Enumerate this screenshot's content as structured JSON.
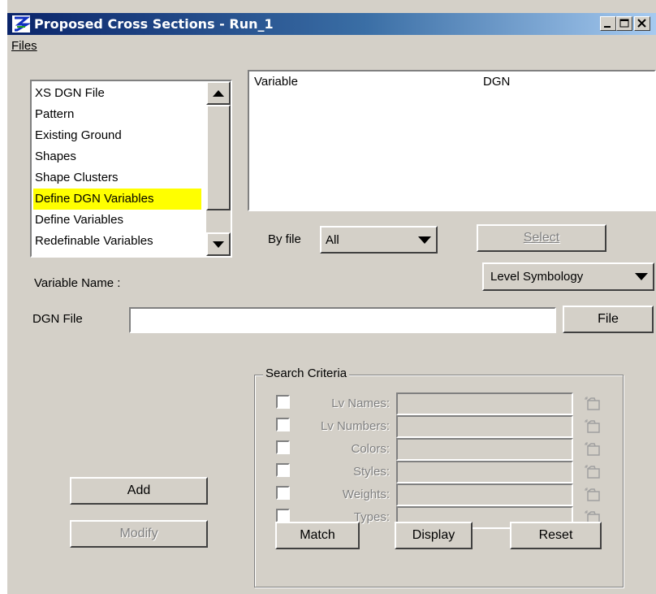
{
  "window": {
    "title": "Proposed Cross Sections - Run_1",
    "controls": {
      "minimize": "_",
      "maximize": "□",
      "close": "×"
    }
  },
  "menu": {
    "files": "Files"
  },
  "categories": {
    "items": [
      {
        "label": "XS DGN File",
        "selected": false
      },
      {
        "label": "Pattern",
        "selected": false
      },
      {
        "label": "Existing Ground",
        "selected": false
      },
      {
        "label": "Shapes",
        "selected": false
      },
      {
        "label": "Shape Clusters",
        "selected": false
      },
      {
        "label": "Define DGN Variables",
        "selected": true
      },
      {
        "label": "Define Variables",
        "selected": false
      },
      {
        "label": "Redefinable Variables",
        "selected": false
      }
    ],
    "highlight_color": "#ffff00"
  },
  "variable_table": {
    "columns": [
      "Variable",
      "DGN"
    ],
    "rows": []
  },
  "by_file": {
    "label": "By file",
    "value": "All"
  },
  "select_button": "Select",
  "variable_name_label": "Variable Name :",
  "symbology_dropdown": "Level Symbology",
  "dgn_file": {
    "label": "DGN File",
    "value": "",
    "button": "File"
  },
  "search_criteria": {
    "title": "Search Criteria",
    "rows": [
      {
        "label": "Lv Names:"
      },
      {
        "label": "Lv Numbers:"
      },
      {
        "label": "Colors:"
      },
      {
        "label": "Styles:"
      },
      {
        "label": "Weights:"
      },
      {
        "label": "Types:"
      }
    ],
    "buttons": {
      "match": "Match",
      "display": "Display",
      "reset": "Reset"
    }
  },
  "actions": {
    "add": "Add",
    "modify": "Modify"
  },
  "colors": {
    "face": "#d4d0c8",
    "title_start": "#0a246a",
    "title_end": "#a6caf0"
  }
}
